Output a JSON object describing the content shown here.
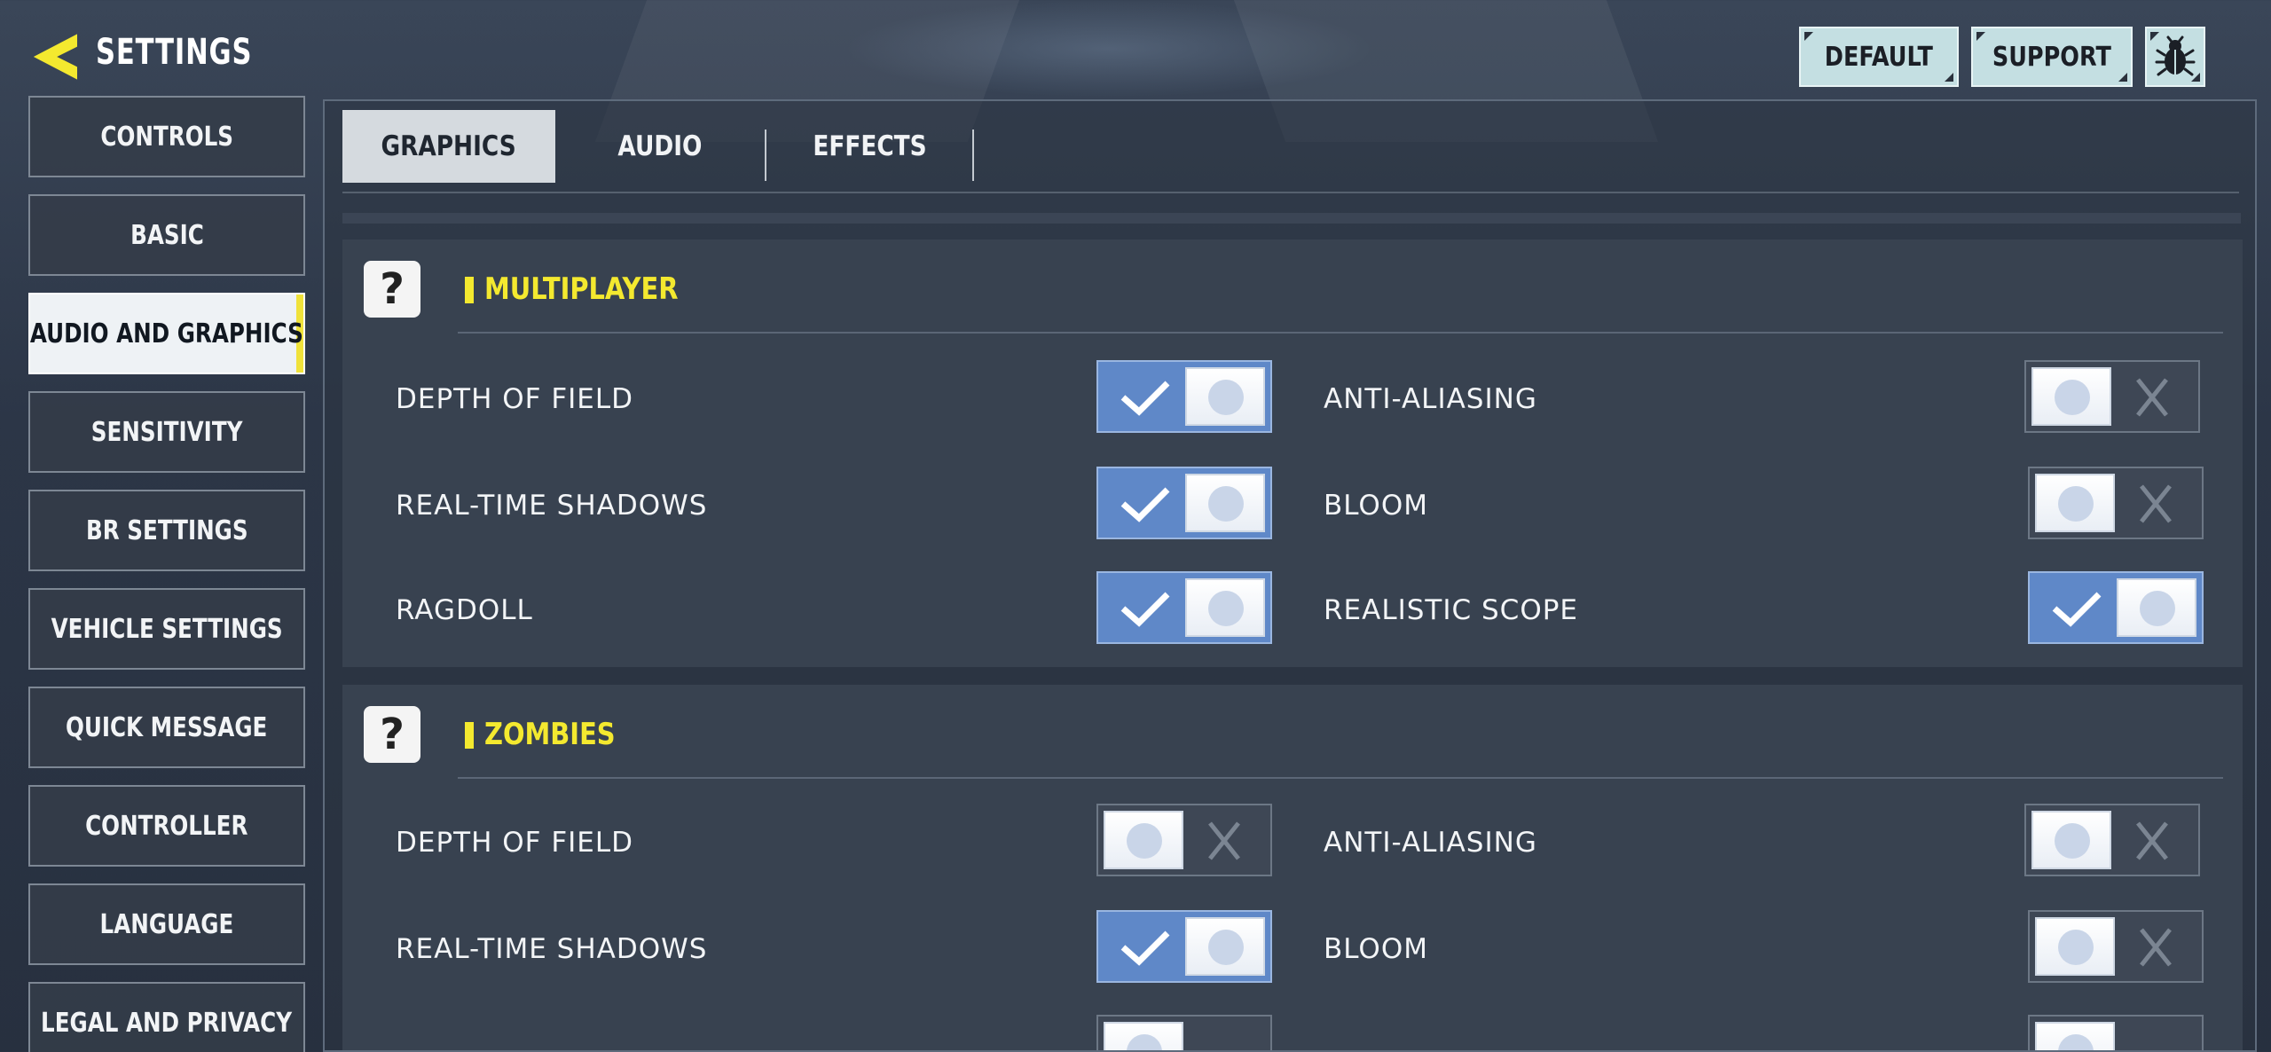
{
  "header": {
    "title": "SETTINGS",
    "default_label": "DEFAULT",
    "support_label": "SUPPORT"
  },
  "sidebar": {
    "items": [
      {
        "label": "CONTROLS",
        "active": false
      },
      {
        "label": "BASIC",
        "active": false
      },
      {
        "label": "AUDIO AND GRAPHICS",
        "active": true
      },
      {
        "label": "SENSITIVITY",
        "active": false
      },
      {
        "label": "BR SETTINGS",
        "active": false
      },
      {
        "label": "VEHICLE SETTINGS",
        "active": false
      },
      {
        "label": "QUICK MESSAGE",
        "active": false
      },
      {
        "label": "CONTROLLER",
        "active": false
      },
      {
        "label": "LANGUAGE",
        "active": false
      },
      {
        "label": "LEGAL AND PRIVACY",
        "active": false
      }
    ]
  },
  "tabs": [
    {
      "label": "GRAPHICS",
      "active": true
    },
    {
      "label": "AUDIO",
      "active": false
    },
    {
      "label": "EFFECTS",
      "active": false
    }
  ],
  "sections": [
    {
      "title": "MULTIPLAYER",
      "help_glyph": "?",
      "options": [
        {
          "label": "DEPTH OF FIELD",
          "on": true
        },
        {
          "label": "ANTI-ALIASING",
          "on": false
        },
        {
          "label": "REAL-TIME SHADOWS",
          "on": true
        },
        {
          "label": "BLOOM",
          "on": false
        },
        {
          "label": "RAGDOLL",
          "on": true
        },
        {
          "label": "REALISTIC SCOPE",
          "on": true
        }
      ]
    },
    {
      "title": "ZOMBIES",
      "help_glyph": "?",
      "options": [
        {
          "label": "DEPTH OF FIELD",
          "on": false
        },
        {
          "label": "ANTI-ALIASING",
          "on": false
        },
        {
          "label": "REAL-TIME SHADOWS",
          "on": true
        },
        {
          "label": "BLOOM",
          "on": false
        }
      ]
    }
  ],
  "colors": {
    "accent_yellow": "#f4e92f",
    "toggle_on": "#5f88c8",
    "button_bg": "#c4dfe2"
  },
  "icons": {
    "back": "chevron-left-icon",
    "bug": "bug-icon",
    "help": "help-icon",
    "check": "check-icon",
    "cross": "close-icon"
  }
}
